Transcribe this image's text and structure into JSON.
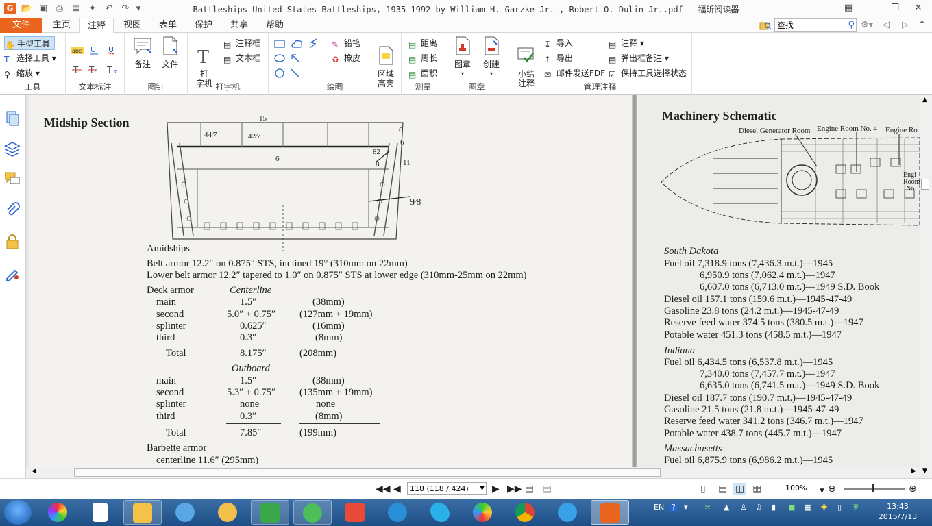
{
  "window": {
    "title": "Battleships United States Battleships, 1935-1992 by William H. Garzke Jr. , Robert O. Dulin Jr..pdf - 福昕阅读器"
  },
  "tabs": {
    "file": "文件",
    "items": [
      "主页",
      "注释",
      "视图",
      "表单",
      "保护",
      "共享",
      "帮助"
    ],
    "active": "注释"
  },
  "search": {
    "value": "查找"
  },
  "ribbon": {
    "tools": {
      "label": "工具",
      "hand": "手型工具",
      "select": "选择工具",
      "zoom": "缩放"
    },
    "text_markup": {
      "label": "文本标注"
    },
    "pin": {
      "label": "图钉",
      "note": "备注",
      "file": "文件"
    },
    "typewriter": {
      "label": "打字机",
      "type": "打\n字机",
      "callout": "注释框",
      "textbox": "文本框"
    },
    "drawing": {
      "label": "绘图",
      "pencil": "铅笔",
      "eraser": "橡皮",
      "area_highlight": "区域\n高亮"
    },
    "measure": {
      "label": "测量",
      "distance": "距离",
      "perimeter": "周长",
      "area": "面积"
    },
    "stamp": {
      "label": "图章",
      "stamp": "图章",
      "create": "创建"
    },
    "manage": {
      "label": "管理注释",
      "summary": "小结\n注释",
      "import": "导入",
      "export": "导出",
      "email": "邮件发送FDF",
      "comments": "注释",
      "popup": "弹出框备注",
      "keep_tool": "保持工具选择状态"
    }
  },
  "document": {
    "left": {
      "title": "Midship Section",
      "figure_labels": {
        "top": "15",
        "f44": "44⁄7",
        "f42": "42⁄7",
        "six_mid": "6",
        "six_a": "6",
        "six_b": "6",
        "eleven": "11",
        "f82": "82",
        "eight": "8",
        "f98": "9⁄8"
      },
      "lines": [
        "Amidships",
        "Belt armor 12.2″ on 0.875″ STS, inclined 19° (310mm on 22mm)",
        "Lower belt armor 12.2″ tapered to 1.0″ on 0.875″ STS at lower edge (310mm-25mm on 22mm)"
      ],
      "deck_armor": "Deck armor",
      "centerline": "Centerline",
      "outboard": "Outboard",
      "centerline_rows": [
        {
          "name": "main",
          "inch": "1.5″",
          "mm": "(38mm)"
        },
        {
          "name": "second",
          "inch": "5.0″ + 0.75″",
          "mm": "(127mm + 19mm)"
        },
        {
          "name": "splinter",
          "inch": "0.625″",
          "mm": "(16mm)"
        },
        {
          "name": "third",
          "inch": "0.3″",
          "mm": "(8mm)"
        }
      ],
      "centerline_total": {
        "name": "Total",
        "inch": "8.175″",
        "mm": "(208mm)"
      },
      "outboard_rows": [
        {
          "name": "main",
          "inch": "1.5″",
          "mm": "(38mm)"
        },
        {
          "name": "second",
          "inch": "5.3″ + 0.75″",
          "mm": "(135mm + 19mm)"
        },
        {
          "name": "splinter",
          "inch": "none",
          "mm": "none"
        },
        {
          "name": "third",
          "inch": "0.3″",
          "mm": "(8mm)"
        }
      ],
      "outboard_total": {
        "name": "Total",
        "inch": "7.85″",
        "mm": "(199mm)"
      },
      "barbette": "Barbette armor",
      "barbette_centerline": "centerline 11.6″ (295mm)"
    },
    "right": {
      "title": "Machinery Schematic",
      "diagram_labels": {
        "diesel": "Diesel Generator Room",
        "engine4": "Engine Room No. 4",
        "engine": "Engine Ro",
        "engi": "Engi",
        "room": "Room",
        "no": "No."
      },
      "sections": [
        {
          "ship": "South Dakota",
          "lines": [
            {
              "text": "Fuel oil 7,318.9 tons (7,436.3 m.t.)—1945",
              "indent": false
            },
            {
              "text": "6,950.9 tons (7,062.4 m.t.)—1947",
              "indent": true
            },
            {
              "text": "6,607.0 tons (6,713.0 m.t.)—1949 S.D. Book",
              "indent": true
            },
            {
              "text": "Diesel oil 157.1 tons (159.6 m.t.)—1945-47-49",
              "indent": false
            },
            {
              "text": "Gasoline 23.8 tons (24.2 m.t.)—1945-47-49",
              "indent": false
            },
            {
              "text": "Reserve feed water 374.5 tons (380.5 m.t.)—1947",
              "indent": false
            },
            {
              "text": "Potable water 451.3 tons (458.5 m.t.)—1947",
              "indent": false
            }
          ]
        },
        {
          "ship": "Indiana",
          "lines": [
            {
              "text": "Fuel oil 6,434.5 tons (6,537.8 m.t.)—1945",
              "indent": false
            },
            {
              "text": "7,340.0 tons (7,457.7 m.t.)—1947",
              "indent": true
            },
            {
              "text": "6,635.0 tons (6,741.5 m.t.)—1949 S.D. Book",
              "indent": true
            },
            {
              "text": "Diesel oil 187.7 tons (190.7 m.t.)—1945-47-49",
              "indent": false
            },
            {
              "text": "Gasoline 21.5 tons (21.8 m.t.)—1945-47-49",
              "indent": false
            },
            {
              "text": "Reserve feed water 341.2 tons (346.7 m.t.)—1947",
              "indent": false
            },
            {
              "text": "Potable water 438.7 tons (445.7 m.t.)—1947",
              "indent": false
            }
          ]
        },
        {
          "ship": "Massachusetts",
          "lines": [
            {
              "text": "Fuel oil 6,875.9 tons (6,986.2 m.t.)—1945",
              "indent": false
            }
          ]
        }
      ]
    }
  },
  "status": {
    "page_box": "118 (118 / 424)",
    "zoom": "100%"
  },
  "taskbar": {
    "lang": "EN",
    "time": "13:43",
    "date": "2015/7/13"
  },
  "colors": {
    "accent": "#e9641c",
    "taskbar": "#2a5f98",
    "page": "#f3f2ee"
  }
}
